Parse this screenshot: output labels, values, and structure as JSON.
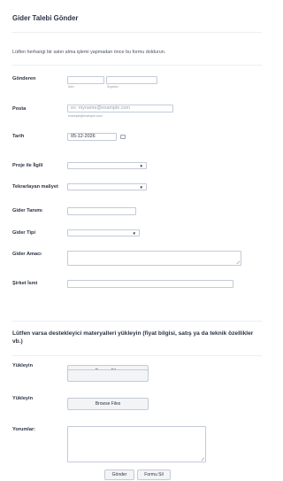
{
  "form": {
    "title": "Gider Talebi Gönder",
    "intro": "Lütfen herhangi bir satın alma işlemi yapmadan önce bu formu doldurun."
  },
  "fields": {
    "sender": {
      "label": "Gönderen",
      "first_sublabel": "İsim",
      "last_sublabel": "Soyisim",
      "first_value": "",
      "last_value": ""
    },
    "email": {
      "label": "Posta",
      "placeholder": "ex: myname@example.com",
      "sublabel": "example@example.com"
    },
    "date": {
      "label": "Tarih",
      "value": "05-12-2026"
    },
    "project": {
      "label": "Proje ile İlgili",
      "selected": ""
    },
    "recurring": {
      "label": "Tekrarlayan maliyet",
      "selected": ""
    },
    "description": {
      "label": "Gider Tanımı",
      "value": ""
    },
    "type": {
      "label": "Gider Tipi",
      "selected": ""
    },
    "purpose": {
      "label": "Gider Amacı",
      "value": ""
    },
    "company": {
      "label": "Şirket İsmi",
      "value": ""
    }
  },
  "uploads": {
    "heading": "Lütfen varsa destekleyici materyalleri yükleyin (fiyat bilgisi, satış ya da teknik özellikler vb.)",
    "upload1": {
      "label": "Yükleyin",
      "button": "Browse Files"
    },
    "upload2": {
      "label": "Yükleyin",
      "button": "Browse Files"
    },
    "comments": {
      "label": "Yorumlar:",
      "value": ""
    }
  },
  "actions": {
    "submit": "Gönder",
    "clear": "Formu Sil"
  },
  "icons": {
    "select_caret": "chevron-down-icon",
    "date_picker": "calendar-icon"
  },
  "colors": {
    "text": "#2c3345",
    "border": "#c3cad8",
    "button_bg": "#f3f4f6"
  }
}
